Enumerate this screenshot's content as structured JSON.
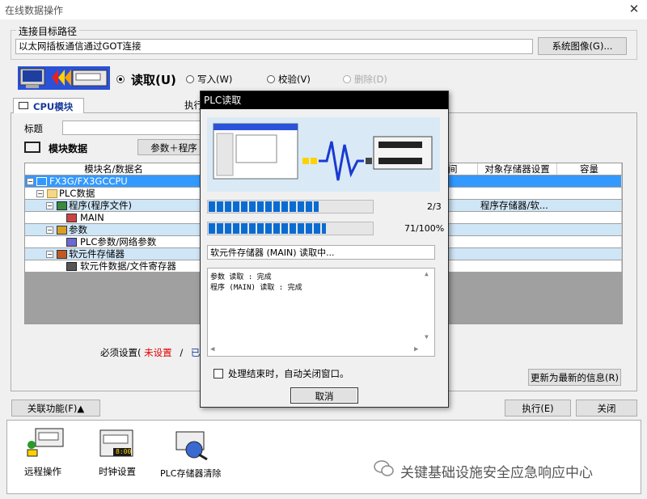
{
  "window": {
    "title": "在线数据操作",
    "close_glyph": "✕"
  },
  "connection": {
    "group_label": "连接目标路径",
    "path_value": "以太网插板通信通过GOT连接",
    "system_image_button": "系统图像(G)..."
  },
  "mode": {
    "read_label": "读取(U)",
    "write_label": "写入(W)",
    "verify_label": "校验(V)",
    "delete_label": "删除(D)",
    "selected": "read"
  },
  "tabs": {
    "cpu_tab": "CPU模块",
    "exec_partial": "执行"
  },
  "title_field": {
    "label": "标题",
    "value": ""
  },
  "module_data": {
    "label": "模块数据",
    "params_button_partial": "参数＋程序"
  },
  "tree": {
    "columns": [
      "模块名/数据名",
      "间",
      "对象存储器设置",
      "容量"
    ],
    "rows": [
      {
        "label": "FX3G/FX3GCCPU",
        "storage": "",
        "style": "sel"
      },
      {
        "label": "PLC数据",
        "storage": "",
        "style": "white"
      },
      {
        "label": "程序(程序文件)",
        "storage": "程序存储器/软...",
        "style": "alt"
      },
      {
        "label": "MAIN",
        "storage": "",
        "style": "white"
      },
      {
        "label": "参数",
        "storage": "",
        "style": "alt"
      },
      {
        "label": "PLC参数/网络参数",
        "storage": "",
        "style": "white"
      },
      {
        "label": "软元件存储器",
        "storage": "",
        "style": "alt"
      },
      {
        "label": "软元件数据/文件寄存器",
        "storage": "",
        "style": "white"
      }
    ]
  },
  "required": {
    "label": "必须设置(",
    "unset": "未设置",
    "sep": "/",
    "tail": "已"
  },
  "refresh_button": "更新为最新的信息(R)",
  "related_button": "关联功能(F)▲",
  "execute_button": "执行(E)",
  "close_button": "关闭",
  "tools": [
    {
      "label": "远程操作",
      "icon": "remote-operation-icon"
    },
    {
      "label": "时钟设置",
      "icon": "clock-setting-icon",
      "clock_text": "8:00"
    },
    {
      "label": "PLC存储器清除",
      "icon": "plc-memory-clear-icon"
    }
  ],
  "dialog": {
    "title": "PLC读取",
    "progress1": {
      "text": "2/3",
      "fraction": 0.667
    },
    "progress2": {
      "text": "71/100%",
      "fraction": 0.71
    },
    "status": "软元件存储器 (MAIN) 读取中...",
    "log_lines": [
      "参数 读取 : 完成",
      "程序 (MAIN) 读取 : 完成"
    ],
    "auto_close_label": "处理结束时，自动关闭窗口。",
    "cancel_button": "取消"
  },
  "watermark": "关键基础设施安全应急响应中心",
  "colors": {
    "selection": "#3399ff",
    "alt_row": "#cfe6f7",
    "unset_red": "#e00000",
    "progress": "#0a6cd2"
  }
}
